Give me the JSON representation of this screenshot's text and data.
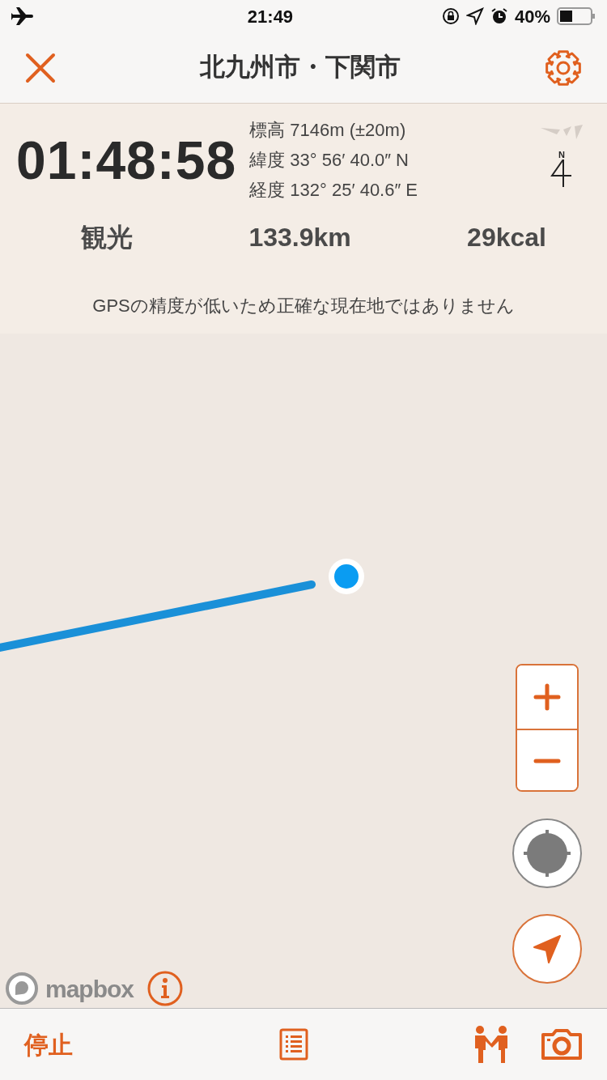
{
  "status_bar": {
    "time": "21:49",
    "battery": "40%"
  },
  "header": {
    "title": "北九州市・下関市"
  },
  "info": {
    "elapsed": "01:48:58",
    "coords": [
      {
        "label": "標高",
        "value": "7146m (±20m)"
      },
      {
        "label": "緯度",
        "value": "33° 56′ 40.0″ N"
      },
      {
        "label": "経度",
        "value": "132° 25′ 40.6″ E"
      }
    ],
    "compass": "N",
    "activity": "観光",
    "distance": "133.9km",
    "calories": "29kcal",
    "notice": "GPSの精度が低いため正確な現在地ではありません"
  },
  "map": {
    "attribution": "mapbox"
  },
  "toolbar": {
    "stop": "停止"
  }
}
